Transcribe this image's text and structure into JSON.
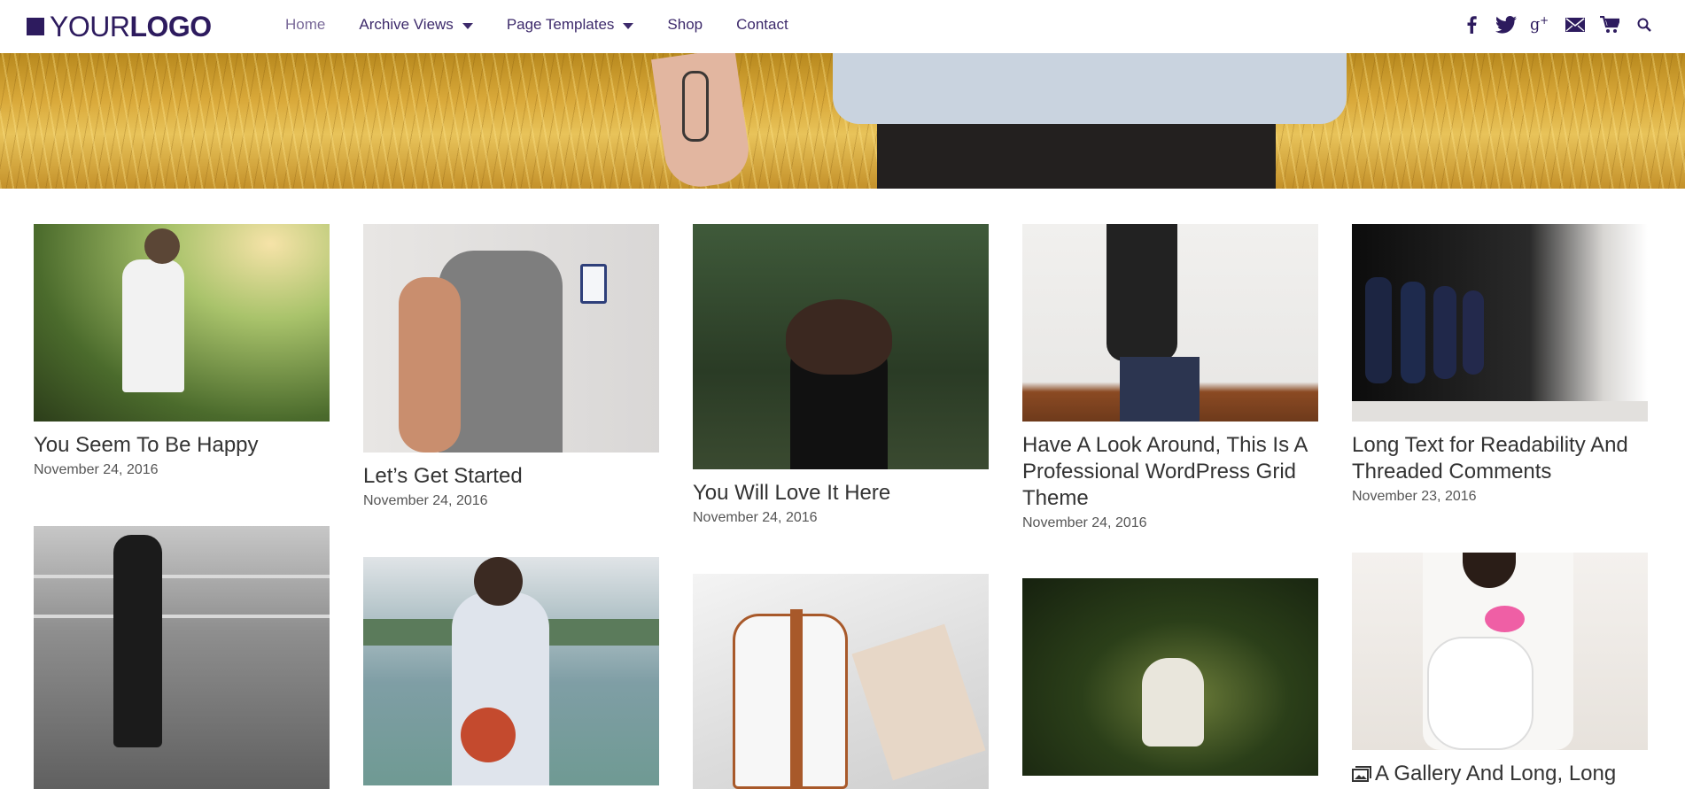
{
  "logo": {
    "part1": "YOUR",
    "part2": "LOGO"
  },
  "nav": [
    {
      "label": "Home",
      "active": true,
      "dropdown": false
    },
    {
      "label": "Archive Views",
      "active": false,
      "dropdown": true
    },
    {
      "label": "Page Templates",
      "active": false,
      "dropdown": true
    },
    {
      "label": "Shop",
      "active": false,
      "dropdown": false
    },
    {
      "label": "Contact",
      "active": false,
      "dropdown": false
    }
  ],
  "social": [
    "facebook-icon",
    "twitter-icon",
    "google-plus-icon",
    "email-icon",
    "cart-icon",
    "search-icon"
  ],
  "colors": {
    "brand": "#2d1b5e",
    "nav_text": "#3d2a6b",
    "nav_active": "#7a6a99"
  },
  "posts": [
    {
      "title": "You Seem To Be Happy",
      "date": "November 24, 2016"
    },
    {
      "title": "Let’s Get Started",
      "date": "November 24, 2016"
    },
    {
      "title": "You Will Love It Here",
      "date": "November 24, 2016"
    },
    {
      "title": "Have A Look Around, This Is A Professional WordPress Grid Theme",
      "date": "November 24, 2016"
    },
    {
      "title": "Long Text for Readability And Threaded Comments",
      "date": "November 23, 2016"
    },
    {
      "title": "",
      "date": ""
    },
    {
      "title": "",
      "date": ""
    },
    {
      "title": "",
      "date": ""
    },
    {
      "title": "",
      "date": ""
    },
    {
      "title": "A Gallery And Long, Long",
      "date": "",
      "icon": "gallery-icon"
    }
  ]
}
